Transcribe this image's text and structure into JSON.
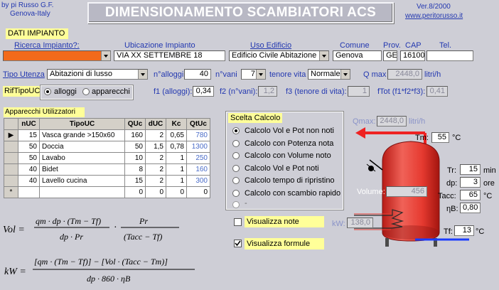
{
  "header": {
    "author_line1": "by pi Russo G.F.",
    "author_line2": "Genova-Italy",
    "title": "DIMENSIONAMENTO SCAMBIATORI ACS",
    "version": "Ver.8/2000",
    "website": "www.peritorusso.it"
  },
  "impianto": {
    "section_label": "DATI IMPIANTO",
    "ricerca_label": "Ricerca Impianto?:",
    "ubicazione_label": "Ubicazione Impianto",
    "ubicazione_value": "VIA XX SETTEMBRE 18",
    "uso_label": "Uso Edificio",
    "uso_value": "Edificio Civile Abitazione",
    "comune_label": "Comune",
    "comune_value": "Genova",
    "prov_label": "Prov.",
    "prov_value": "GE",
    "cap_label": "CAP",
    "cap_value": "16100",
    "tel_label": "Tel.",
    "tel_value": ""
  },
  "utenza": {
    "tipo_label": "Tipo Utenza",
    "tipo_value": "Abitazioni di lusso",
    "nalloggi_label": "n°alloggi",
    "nalloggi_value": "40",
    "nvani_label": "n°vani",
    "nvani_value": "7",
    "tenore_label": "tenore vita",
    "tenore_value": "Normale",
    "qmax_label": "Q max",
    "qmax_value": "2448,0",
    "qmax_unit": "litri/h"
  },
  "rif": {
    "label": "RifTipoUC",
    "opt1": "alloggi",
    "opt2": "apparecchi",
    "f1_label": "f1 (alloggi):",
    "f1_value": "0,34",
    "f2_label": "f2 (n°vani):",
    "f2_value": "1,2",
    "f3_label": "f3 (tenore di vita):",
    "f3_value": "1",
    "ftot_label": "fTot (f1*f2*f3):",
    "ftot_value": "0,41"
  },
  "apparecchi": {
    "label": "Apparecchi Utilizzatori",
    "columns": [
      "nUC",
      "TipoUC",
      "QUc",
      "dUC",
      "Kc",
      "QtUc"
    ],
    "rows": [
      [
        "15",
        "Vasca grande >150x60",
        "160",
        "2",
        "0,65",
        "780"
      ],
      [
        "50",
        "Doccia",
        "50",
        "1,5",
        "0,78",
        "1300"
      ],
      [
        "50",
        "Lavabo",
        "10",
        "2",
        "1",
        "250"
      ],
      [
        "40",
        "Bidet",
        "8",
        "2",
        "1",
        "160"
      ],
      [
        "40",
        "Lavello cucina",
        "15",
        "2",
        "1",
        "300"
      ],
      [
        "",
        "",
        "0",
        "0",
        "0",
        "0"
      ]
    ],
    "current_row_marker": "▶",
    "new_row_marker": "*"
  },
  "calcolo": {
    "label": "Scelta Calcolo",
    "options": [
      "Calcolo Vol e Pot non noti",
      "Calcolo con Potenza nota",
      "Calcolo con Volume noto",
      "Calcolo Vol e Pot noti",
      "Calcolo tempo di ripristino",
      "Calcolo con scambio rapido",
      "-"
    ],
    "selected_index": 0
  },
  "checks": {
    "note_label": "Visualizza note",
    "note_checked": false,
    "formule_label": "Visualizza formule",
    "formule_checked": true
  },
  "boiler": {
    "qmax_label": "Qmax:",
    "qmax_value": "2448,0",
    "qmax_unit": "litri/h",
    "tm_label": "Tm:",
    "tm_value": "55",
    "tm_unit": "°C",
    "volume_label": "Volume:",
    "volume_value": "456",
    "kw_label": "kW:",
    "kw_value": "138,0",
    "tr_label": "Tr:",
    "tr_value": "15",
    "tr_unit": "min",
    "dp_label": "dp:",
    "dp_value": "3",
    "dp_unit": "ore",
    "tacc_label": "Tacc:",
    "tacc_value": "65",
    "tacc_unit": "°C",
    "eta_label": "ηB:",
    "eta_value": "0,80",
    "tf_label": "Tf:",
    "tf_value": "13",
    "tf_unit": "°C"
  },
  "formulas": {
    "vol_lhs": "Vol =",
    "vol_num1": "qm · dp · (Tm − Tf)",
    "vol_den1": "dp · Pr",
    "vol_num2": "Pr",
    "vol_den2": "(Tacc − Tf)",
    "kw_lhs": "kW =",
    "kw_num": "[qm · (Tm − Tf)] − [Vol · (Tacc − Tm)]",
    "kw_den": "dp · 860 · ηB"
  },
  "colors": {
    "background": "#ceced6",
    "label_blue": "#2338b0",
    "highlight_yellow": "#ffff99",
    "boiler_red": "#e8302a",
    "search_orange": "#f26a1b"
  }
}
